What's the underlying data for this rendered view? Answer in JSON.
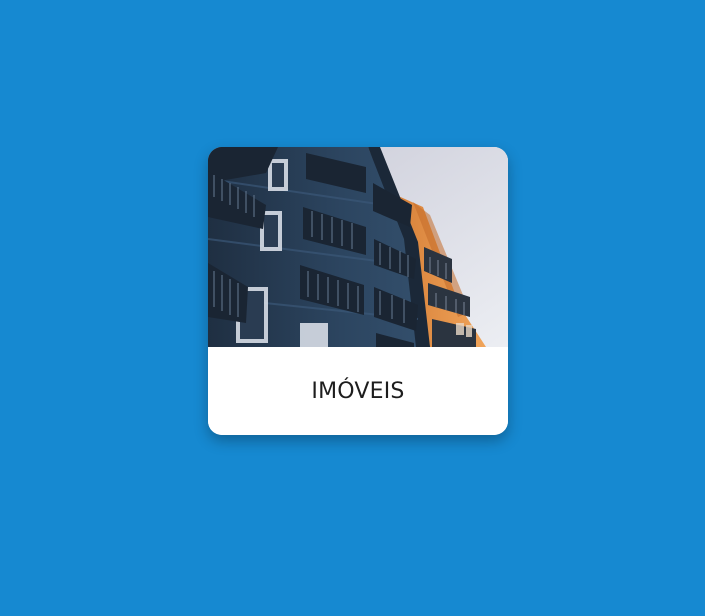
{
  "page": {
    "background_color": "#1689d1"
  },
  "card": {
    "label": "IMÓVEIS",
    "image_icon": "apartment-building-photo",
    "colors": {
      "building_blue": "#273d56",
      "building_orange": "#e79245",
      "sky": "#dcdfe7"
    }
  }
}
